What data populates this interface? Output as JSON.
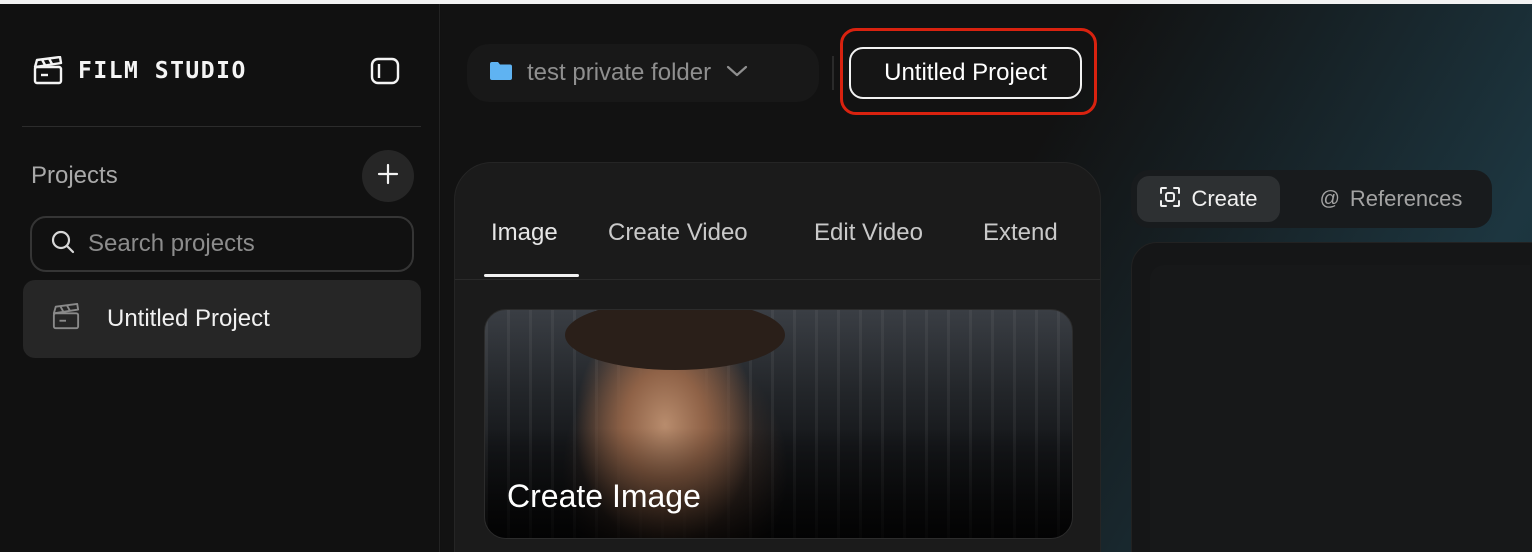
{
  "app": {
    "brand": "FILM STUDIO"
  },
  "sidebar": {
    "projects_heading": "Projects",
    "search": {
      "placeholder": "Search projects",
      "value": ""
    },
    "projects": [
      {
        "label": "Untitled Project",
        "selected": true
      }
    ]
  },
  "header": {
    "folder": {
      "label": "test private folder",
      "icon": "folder-icon",
      "icon_color": "#5fb3f2"
    },
    "project_title": "Untitled Project",
    "highlight_color": "#d9220f"
  },
  "tabs": [
    {
      "label": "Image",
      "active": true
    },
    {
      "label": "Create Video",
      "active": false
    },
    {
      "label": "Edit Video",
      "active": false
    },
    {
      "label": "Extend",
      "active": false
    }
  ],
  "card": {
    "title": "Create Image"
  },
  "mode_switch": {
    "create_label": "Create",
    "references_label": "References",
    "selected": "Create"
  }
}
